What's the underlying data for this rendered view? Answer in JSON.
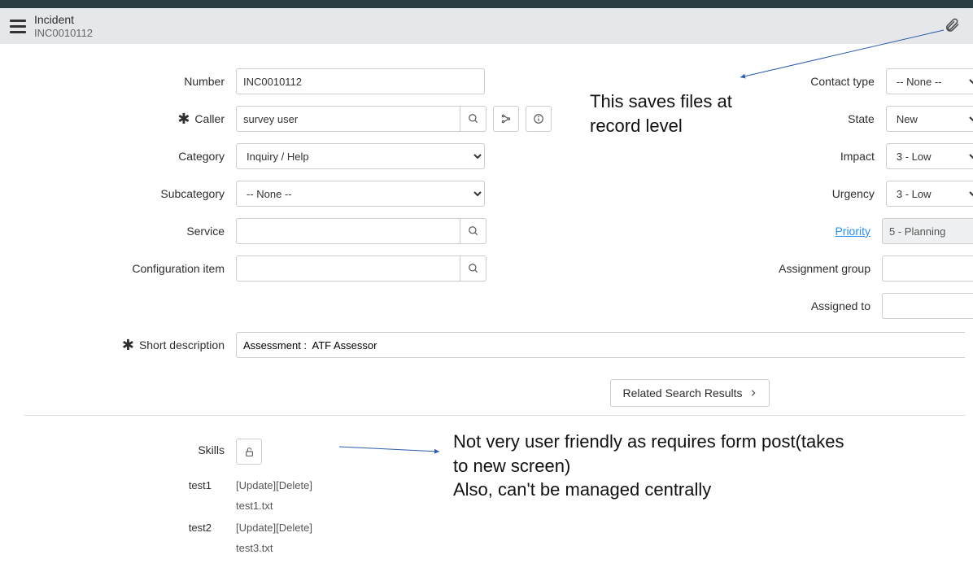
{
  "header": {
    "record_type": "Incident",
    "record_number": "INC0010112"
  },
  "left": {
    "number": {
      "label": "Number",
      "value": "INC0010112"
    },
    "caller": {
      "label": "Caller",
      "value": "survey user",
      "mandatory": true
    },
    "category": {
      "label": "Category",
      "value": "Inquiry / Help"
    },
    "subcategory": {
      "label": "Subcategory",
      "value": "-- None --"
    },
    "service": {
      "label": "Service",
      "value": ""
    },
    "ci": {
      "label": "Configuration item",
      "value": ""
    }
  },
  "right": {
    "contact_type": {
      "label": "Contact type",
      "value": "-- None --"
    },
    "state": {
      "label": "State",
      "value": "New"
    },
    "impact": {
      "label": "Impact",
      "value": "3 - Low"
    },
    "urgency": {
      "label": "Urgency",
      "value": "3 - Low"
    },
    "priority": {
      "label": "Priority",
      "value": "5 - Planning"
    },
    "assignment_group": {
      "label": "Assignment group",
      "value": ""
    },
    "assigned_to": {
      "label": "Assigned to",
      "value": ""
    }
  },
  "short_description": {
    "label": "Short description",
    "value": "Assessment :  ATF Assessor",
    "mandatory": true
  },
  "related_search": "Related Search Results",
  "skills": {
    "label": "Skills"
  },
  "files": [
    {
      "label": "test1",
      "update": "[Update]",
      "delete": "[Delete]",
      "name": "test1.txt"
    },
    {
      "label": "test2",
      "update": "[Update]",
      "delete": "[Delete]",
      "name": "test3.txt"
    }
  ],
  "annotations": {
    "top": "This saves files at record level",
    "bottom": "Not very user friendly as requires form post(takes to new screen)\nAlso, can't be managed centrally"
  }
}
